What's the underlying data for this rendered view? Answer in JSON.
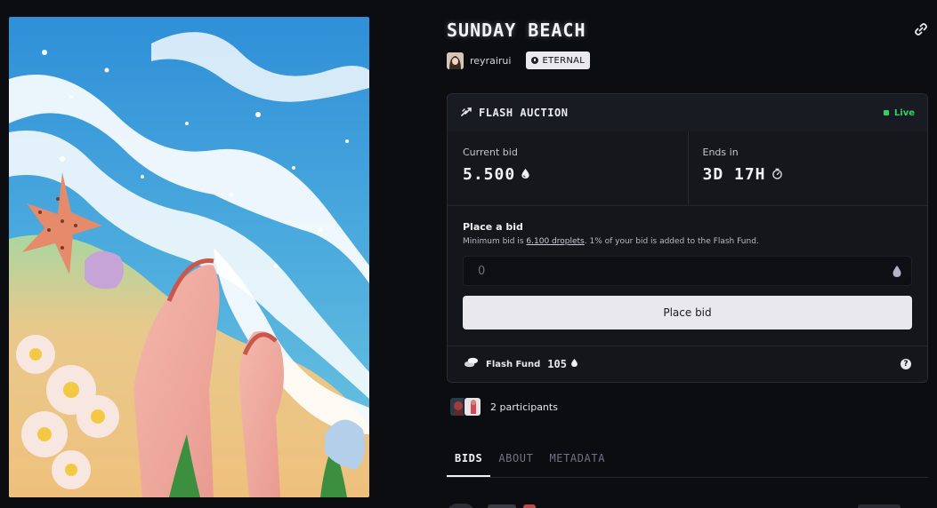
{
  "artwork": {
    "alt": "Sunday Beach artwork"
  },
  "title": "SUNDAY BEACH",
  "creator": {
    "name": "reyrairui"
  },
  "edition_badge": "ETERNAL",
  "auction": {
    "header": "FLASH AUCTION",
    "status": "Live",
    "status_color": "#2fd064",
    "current_bid_label": "Current bid",
    "current_bid_value": "5.500",
    "ends_in_label": "Ends in",
    "ends_in_value": "3D 17H",
    "place_bid_title": "Place a bid",
    "bid_note_prefix": "Minimum bid is ",
    "bid_note_link": "6.100 droplets",
    "bid_note_suffix": ". 1% of your bid is added to the Flash Fund.",
    "input_placeholder": "0",
    "place_bid_button": "Place bid",
    "flash_fund_label": "Flash Fund",
    "flash_fund_value": "105",
    "help": "?"
  },
  "participants": "2 participants",
  "tabs": [
    {
      "label": "BIDS",
      "active": true
    },
    {
      "label": "ABOUT",
      "active": false
    },
    {
      "label": "METADATA",
      "active": false
    }
  ]
}
